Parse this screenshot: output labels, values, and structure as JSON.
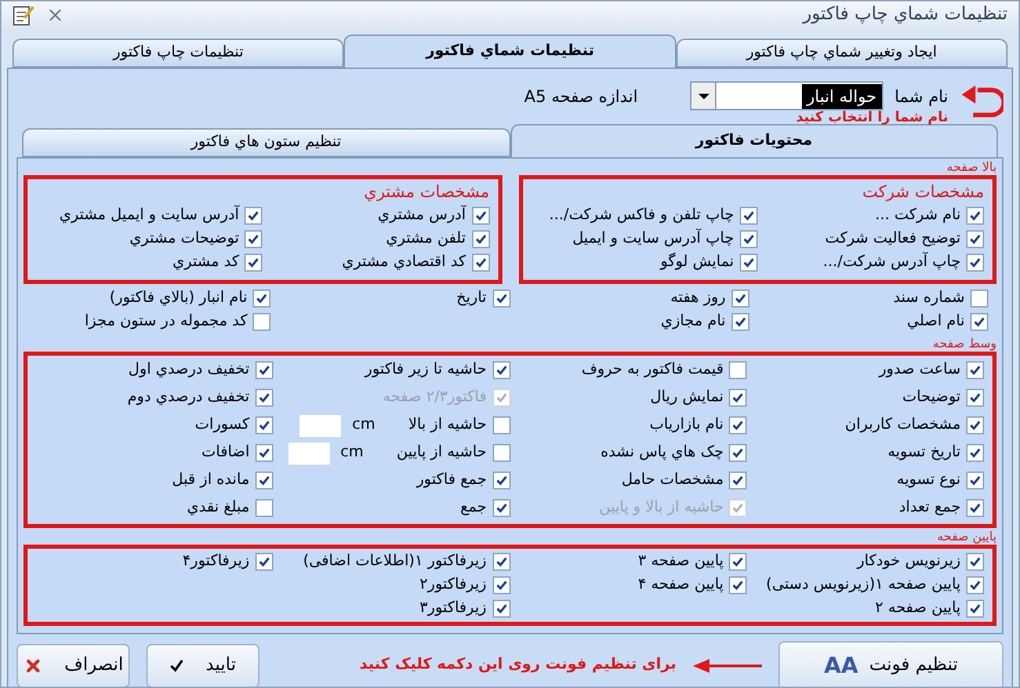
{
  "window": {
    "title": "تنظیمات شماي چاپ فاکتور"
  },
  "tabs": [
    {
      "label": "ایجاد وتغییر شماي چاپ فاکتور",
      "selected": false
    },
    {
      "label": "تنظیمات شماي فاکتور",
      "selected": true
    },
    {
      "label": "تنظیمات چاپ فاکتور",
      "selected": false
    }
  ],
  "name_field": {
    "label": "نام شما",
    "value": "حواله انبار"
  },
  "page_size": "اندازه صفحه A5",
  "name_hint": "نام شما را انتخاب کنید",
  "inner_tabs": [
    {
      "label": "محتویات فاکتور",
      "selected": true
    },
    {
      "label": "تنظیم ستون هاي فاکتور",
      "selected": false
    }
  ],
  "sections": [
    {
      "title": "بالا صفحه",
      "groups": [
        {
          "title": "مشخصات شرکت",
          "columns": [
            [
              {
                "kind": "check",
                "label": "نام شرکت ...",
                "checked": true,
                "disabled": false
              },
              {
                "kind": "check",
                "label": "توضیح فعالیت شرکت",
                "checked": true,
                "disabled": false
              },
              {
                "kind": "check",
                "label": "چاپ آدرس شرکت/...",
                "checked": true,
                "disabled": false
              }
            ],
            [
              {
                "kind": "check",
                "label": "چاپ تلفن و فاکس شرکت/...",
                "checked": true,
                "disabled": false
              },
              {
                "kind": "check",
                "label": "چاپ آدرس سایت و ایمیل",
                "checked": true,
                "disabled": false
              },
              {
                "kind": "check",
                "label": "نمایش لوگو",
                "checked": true,
                "disabled": false
              }
            ]
          ]
        },
        {
          "title": "مشخصات مشتري",
          "columns": [
            [
              {
                "kind": "check",
                "label": "آدرس مشتري",
                "checked": true,
                "disabled": false
              },
              {
                "kind": "check",
                "label": "تلفن مشتري",
                "checked": true,
                "disabled": false
              },
              {
                "kind": "check",
                "label": "کد اقتصادي مشتري",
                "checked": true,
                "disabled": false
              }
            ],
            [
              {
                "kind": "check",
                "label": "آدرس سایت و ایمیل مشتري",
                "checked": true,
                "disabled": false
              },
              {
                "kind": "check",
                "label": "توضیحات مشتري",
                "checked": true,
                "disabled": false
              },
              {
                "kind": "check",
                "label": "کد مشتري",
                "checked": true,
                "disabled": false
              }
            ]
          ]
        }
      ],
      "columns": [
        [
          {
            "kind": "check",
            "label": "شماره سند",
            "checked": false,
            "disabled": false
          },
          {
            "kind": "check",
            "label": "نام اصلي",
            "checked": true,
            "disabled": false
          }
        ],
        [
          {
            "kind": "check",
            "label": "روز هفته",
            "checked": true,
            "disabled": false
          },
          {
            "kind": "check",
            "label": "نام مجازي",
            "checked": true,
            "disabled": false
          }
        ],
        [
          {
            "kind": "check",
            "label": "تاریخ",
            "checked": true,
            "disabled": false
          }
        ],
        [
          {
            "kind": "check",
            "label": "نام انبار (بالاي فاکتور)",
            "checked": true,
            "disabled": false
          },
          {
            "kind": "check",
            "label": "کد مجموله در ستون مجزا",
            "checked": false,
            "disabled": false
          }
        ]
      ]
    },
    {
      "title": "وسط صفحه",
      "columns": [
        [
          {
            "kind": "check",
            "label": "ساعت صدور",
            "checked": true,
            "disabled": false
          },
          {
            "kind": "check",
            "label": "توضیحات",
            "checked": true,
            "disabled": false
          },
          {
            "kind": "check",
            "label": "مشخصات کاربران",
            "checked": true,
            "disabled": false
          },
          {
            "kind": "check",
            "label": "تاریخ تسویه",
            "checked": true,
            "disabled": false
          },
          {
            "kind": "check",
            "label": "نوع تسویه",
            "checked": true,
            "disabled": false
          },
          {
            "kind": "check",
            "label": "جمع تعداد",
            "checked": true,
            "disabled": false
          }
        ],
        [
          {
            "kind": "check",
            "label": "قیمت فاکتور به حروف",
            "checked": false,
            "disabled": false
          },
          {
            "kind": "check",
            "label": "نمایش ریال",
            "checked": true,
            "disabled": false
          },
          {
            "kind": "check",
            "label": "نام بازاریاب",
            "checked": true,
            "disabled": false
          },
          {
            "kind": "check",
            "label": "چک هاي پاس نشده",
            "checked": true,
            "disabled": false
          },
          {
            "kind": "check",
            "label": "مشخصات حامل",
            "checked": true,
            "disabled": false
          },
          {
            "kind": "check",
            "label": "حاشیه از بالا و پایین",
            "checked": true,
            "disabled": true
          }
        ],
        [
          {
            "kind": "check",
            "label": "حاشیه تا زیر فاکتور",
            "checked": true,
            "disabled": false
          },
          {
            "kind": "check",
            "label": "فاکتور۲/۳ صفحه",
            "checked": true,
            "disabled": true
          },
          {
            "kind": "measure",
            "label": "حاشیه از بالا",
            "unit": "cm",
            "checked": false,
            "disabled": false
          },
          {
            "kind": "measure",
            "label": "حاشیه از پایین",
            "unit": "cm",
            "checked": false,
            "disabled": false
          },
          {
            "kind": "check",
            "label": "جمع فاکتور",
            "checked": true,
            "disabled": false
          },
          {
            "kind": "check",
            "label": "جمع",
            "checked": true,
            "disabled": false
          }
        ],
        [
          {
            "kind": "check",
            "label": "تخفیف درصدي اول",
            "checked": true,
            "disabled": false
          },
          {
            "kind": "check",
            "label": "تخفیف درصدي دوم",
            "checked": true,
            "disabled": false
          },
          {
            "kind": "check",
            "label": "کسورات",
            "checked": true,
            "disabled": false
          },
          {
            "kind": "check",
            "label": "اضافات",
            "checked": true,
            "disabled": false
          },
          {
            "kind": "check",
            "label": "مانده از قبل",
            "checked": true,
            "disabled": false
          },
          {
            "kind": "check",
            "label": "مبلغ نقدي",
            "checked": false,
            "disabled": false
          }
        ]
      ]
    },
    {
      "title": "پایین صفحه",
      "columns": [
        [
          {
            "kind": "check",
            "label": "زیرنویس خودکار",
            "checked": true,
            "disabled": false
          },
          {
            "kind": "check",
            "label": "پایین صفحه ۱(زیرنویس دستی)",
            "checked": true,
            "disabled": false
          },
          {
            "kind": "check",
            "label": "پایین صفحه ۲",
            "checked": true,
            "disabled": false
          }
        ],
        [
          {
            "kind": "check",
            "label": "پایین صفحه ۳",
            "checked": true,
            "disabled": false
          },
          {
            "kind": "check",
            "label": "پایین صفحه ۴",
            "checked": true,
            "disabled": false
          }
        ],
        [
          {
            "kind": "check",
            "label": "زیرفاکتور ۱(اطلاعات اضافی)",
            "checked": true,
            "disabled": false
          },
          {
            "kind": "check",
            "label": "زیرفاکتور۲",
            "checked": true,
            "disabled": false
          },
          {
            "kind": "check",
            "label": "زیرفاکتور۳",
            "checked": true,
            "disabled": false
          }
        ],
        [
          {
            "kind": "check",
            "label": "زیرفاکتور۴",
            "checked": true,
            "disabled": false
          }
        ]
      ]
    }
  ],
  "footer": {
    "font_button": "تنظیم فونت",
    "font_icon_text": "AA",
    "hint": "برای تنظیم فونت روی این دکمه کلیک کنید",
    "ok": "تایید",
    "cancel": "انصراف"
  }
}
